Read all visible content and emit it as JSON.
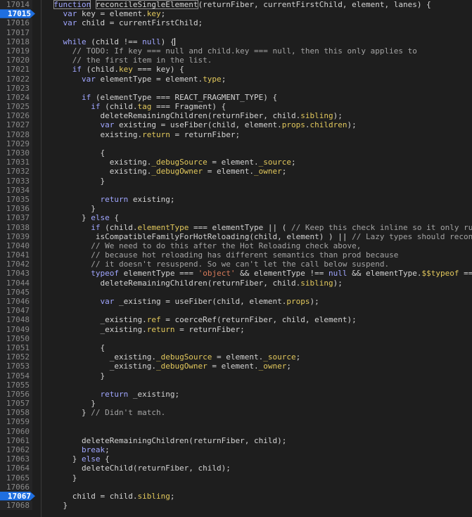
{
  "editor": {
    "line_numbers": [
      "17014",
      "17015",
      "17016",
      "17017",
      "17018",
      "17019",
      "17020",
      "17021",
      "17022",
      "17023",
      "17024",
      "17025",
      "17026",
      "17027",
      "17028",
      "17029",
      "17030",
      "17031",
      "17032",
      "17033",
      "17034",
      "17035",
      "17036",
      "17037",
      "17038",
      "17039",
      "17040",
      "17041",
      "17042",
      "17043",
      "17044",
      "17045",
      "17046",
      "17047",
      "17048",
      "17049",
      "17050",
      "17051",
      "17052",
      "17053",
      "17054",
      "17055",
      "17056",
      "17057",
      "17058",
      "17059",
      "17060",
      "17061",
      "17062",
      "17063",
      "17064",
      "17065",
      "17066",
      "17067",
      "17068"
    ],
    "breakpoint_lines": [
      "17015",
      "17067"
    ],
    "code_lines": [
      [
        [
          "  ",
          ""
        ],
        [
          "function",
          "kw fnbox"
        ],
        [
          " ",
          ""
        ],
        [
          "reconcileSingleElement",
          "fnbox"
        ],
        [
          "(returnFiber, currentFirstChild, element, lanes) {",
          ""
        ]
      ],
      [
        [
          "    ",
          ""
        ],
        [
          "var",
          "kw"
        ],
        [
          " key = element.",
          ""
        ],
        [
          "key",
          "prop"
        ],
        [
          ";",
          ""
        ]
      ],
      [
        [
          "    ",
          ""
        ],
        [
          "var",
          "kw"
        ],
        [
          " child = currentFirstChild;",
          ""
        ]
      ],
      [
        [
          "",
          ""
        ]
      ],
      [
        [
          "    ",
          ""
        ],
        [
          "while",
          "kw"
        ],
        [
          " (child !== ",
          ""
        ],
        [
          "null",
          "kw"
        ],
        [
          ") {",
          ""
        ],
        [
          "",
          "cursor"
        ]
      ],
      [
        [
          "      ",
          ""
        ],
        [
          "// TODO: If key === null and child.key === null, then this only applies to",
          "cm"
        ]
      ],
      [
        [
          "      ",
          ""
        ],
        [
          "// the first item in the list.",
          "cm"
        ]
      ],
      [
        [
          "      ",
          ""
        ],
        [
          "if",
          "kw"
        ],
        [
          " (child.",
          ""
        ],
        [
          "key",
          "prop"
        ],
        [
          " === key) {",
          ""
        ]
      ],
      [
        [
          "        ",
          ""
        ],
        [
          "var",
          "kw"
        ],
        [
          " elementType = element.",
          ""
        ],
        [
          "type",
          "prop"
        ],
        [
          ";",
          ""
        ]
      ],
      [
        [
          "",
          ""
        ]
      ],
      [
        [
          "        ",
          ""
        ],
        [
          "if",
          "kw"
        ],
        [
          " (elementType === REACT_FRAGMENT_TYPE) {",
          ""
        ]
      ],
      [
        [
          "          ",
          ""
        ],
        [
          "if",
          "kw"
        ],
        [
          " (child.",
          ""
        ],
        [
          "tag",
          "prop"
        ],
        [
          " === Fragment) {",
          ""
        ]
      ],
      [
        [
          "            deleteRemainingChildren(returnFiber, child.",
          ""
        ],
        [
          "sibling",
          "prop"
        ],
        [
          ");",
          ""
        ]
      ],
      [
        [
          "            ",
          ""
        ],
        [
          "var",
          "kw"
        ],
        [
          " existing = useFiber(child, element.",
          ""
        ],
        [
          "props",
          "prop"
        ],
        [
          ".",
          ""
        ],
        [
          "children",
          "prop"
        ],
        [
          ");",
          ""
        ]
      ],
      [
        [
          "            existing.",
          ""
        ],
        [
          "return",
          "prop"
        ],
        [
          " = returnFiber;",
          ""
        ]
      ],
      [
        [
          "",
          ""
        ]
      ],
      [
        [
          "            {",
          ""
        ]
      ],
      [
        [
          "              existing.",
          ""
        ],
        [
          "_debugSource",
          "prop"
        ],
        [
          " = element.",
          ""
        ],
        [
          "_source",
          "prop"
        ],
        [
          ";",
          ""
        ]
      ],
      [
        [
          "              existing.",
          ""
        ],
        [
          "_debugOwner",
          "prop"
        ],
        [
          " = element.",
          ""
        ],
        [
          "_owner",
          "prop"
        ],
        [
          ";",
          ""
        ]
      ],
      [
        [
          "            }",
          ""
        ]
      ],
      [
        [
          "",
          ""
        ]
      ],
      [
        [
          "            ",
          ""
        ],
        [
          "return",
          "kw"
        ],
        [
          " existing;",
          ""
        ]
      ],
      [
        [
          "          }",
          ""
        ]
      ],
      [
        [
          "        } ",
          ""
        ],
        [
          "else",
          "kw"
        ],
        [
          " {",
          ""
        ]
      ],
      [
        [
          "          ",
          ""
        ],
        [
          "if",
          "kw"
        ],
        [
          " (child.",
          ""
        ],
        [
          "elementType",
          "prop"
        ],
        [
          " === elementType || ( ",
          ""
        ],
        [
          "// Keep this check inline so it only ru",
          "cm"
        ]
      ],
      [
        [
          "           isCompatibleFamilyForHotReloading(child, element) ) || ",
          ""
        ],
        [
          "// Lazy types should recon",
          "cm"
        ]
      ],
      [
        [
          "          ",
          ""
        ],
        [
          "// We need to do this after the Hot Reloading check above,",
          "cm"
        ]
      ],
      [
        [
          "          ",
          ""
        ],
        [
          "// because hot reloading has different semantics than prod because",
          "cm"
        ]
      ],
      [
        [
          "          ",
          ""
        ],
        [
          "// it doesn't resuspend. So we can't let the call below suspend.",
          "cm"
        ]
      ],
      [
        [
          "          ",
          ""
        ],
        [
          "typeof",
          "kw"
        ],
        [
          " elementType === ",
          ""
        ],
        [
          "'object'",
          "str"
        ],
        [
          " && elementType !== ",
          ""
        ],
        [
          "null",
          "kw"
        ],
        [
          " && elementType.",
          ""
        ],
        [
          "$$typeof",
          "prop"
        ],
        [
          " ==",
          ""
        ]
      ],
      [
        [
          "            deleteRemainingChildren(returnFiber, child.",
          ""
        ],
        [
          "sibling",
          "prop"
        ],
        [
          ");",
          ""
        ]
      ],
      [
        [
          "",
          ""
        ]
      ],
      [
        [
          "            ",
          ""
        ],
        [
          "var",
          "kw"
        ],
        [
          " _existing = useFiber(child, element.",
          ""
        ],
        [
          "props",
          "prop"
        ],
        [
          ");",
          ""
        ]
      ],
      [
        [
          "",
          ""
        ]
      ],
      [
        [
          "            _existing.",
          ""
        ],
        [
          "ref",
          "prop"
        ],
        [
          " = coerceRef(returnFiber, child, element);",
          ""
        ]
      ],
      [
        [
          "            _existing.",
          ""
        ],
        [
          "return",
          "prop"
        ],
        [
          " = returnFiber;",
          ""
        ]
      ],
      [
        [
          "",
          ""
        ]
      ],
      [
        [
          "            {",
          ""
        ]
      ],
      [
        [
          "              _existing.",
          ""
        ],
        [
          "_debugSource",
          "prop"
        ],
        [
          " = element.",
          ""
        ],
        [
          "_source",
          "prop"
        ],
        [
          ";",
          ""
        ]
      ],
      [
        [
          "              _existing.",
          ""
        ],
        [
          "_debugOwner",
          "prop"
        ],
        [
          " = element.",
          ""
        ],
        [
          "_owner",
          "prop"
        ],
        [
          ";",
          ""
        ]
      ],
      [
        [
          "            }",
          ""
        ]
      ],
      [
        [
          "",
          ""
        ]
      ],
      [
        [
          "            ",
          ""
        ],
        [
          "return",
          "kw"
        ],
        [
          " _existing;",
          ""
        ]
      ],
      [
        [
          "          }",
          ""
        ]
      ],
      [
        [
          "        } ",
          ""
        ],
        [
          "// Didn't match.",
          "cm"
        ]
      ],
      [
        [
          "",
          ""
        ]
      ],
      [
        [
          "",
          ""
        ]
      ],
      [
        [
          "        deleteRemainingChildren(returnFiber, child);",
          ""
        ]
      ],
      [
        [
          "        ",
          ""
        ],
        [
          "break",
          "kw"
        ],
        [
          ";",
          ""
        ]
      ],
      [
        [
          "      } ",
          ""
        ],
        [
          "else",
          "kw"
        ],
        [
          " {",
          ""
        ]
      ],
      [
        [
          "        deleteChild(returnFiber, child);",
          ""
        ]
      ],
      [
        [
          "      }",
          ""
        ]
      ],
      [
        [
          "",
          ""
        ]
      ],
      [
        [
          "      child = child.",
          ""
        ],
        [
          "sibling",
          "prop"
        ],
        [
          ";",
          ""
        ]
      ],
      [
        [
          "    }",
          ""
        ]
      ]
    ]
  },
  "colors": {
    "background": "#1e1e1e",
    "gutter": "#252526",
    "breakpoint": "#1f6fe0",
    "keyword": "#a0a6ff",
    "property": "#e2c85c",
    "string": "#d67a5a",
    "comment": "#a4a4a4"
  }
}
